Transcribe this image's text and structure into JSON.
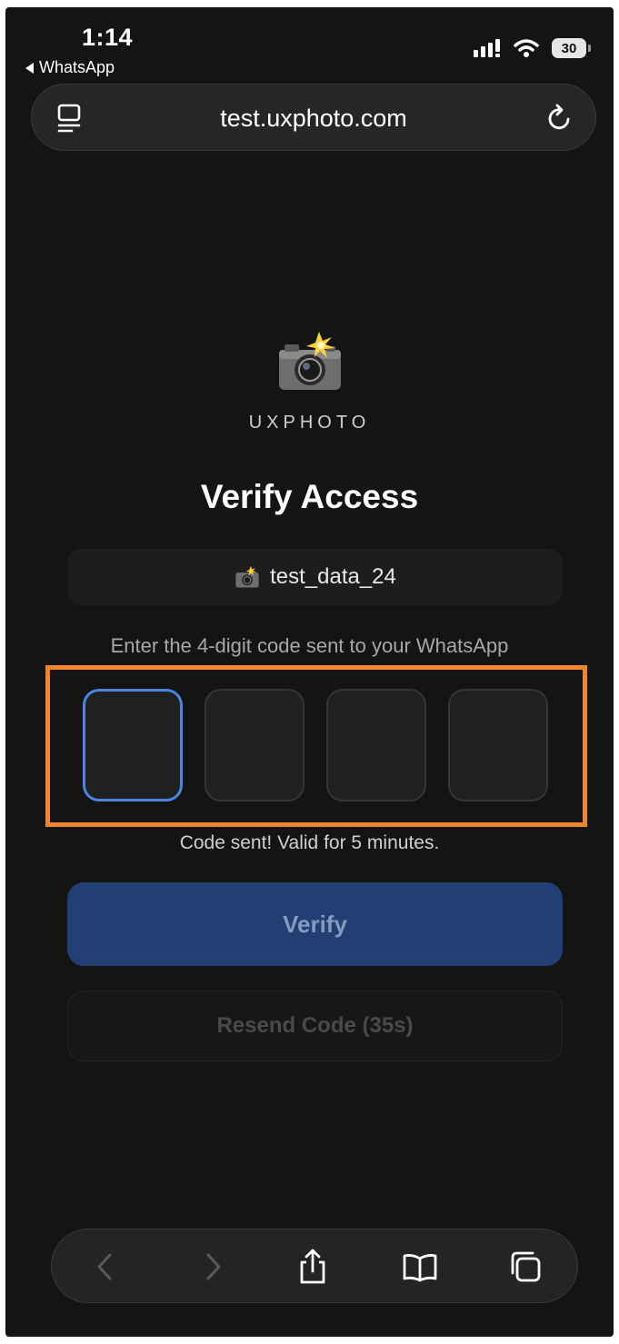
{
  "status_bar": {
    "time": "1:14",
    "back_app": "WhatsApp",
    "battery": "30"
  },
  "browser": {
    "url": "test.uxphoto.com"
  },
  "page": {
    "brand": "UXPHOTO",
    "title": "Verify Access",
    "account": "test_data_24",
    "instruction": "Enter the 4-digit code sent to your WhatsApp",
    "code_digits": [
      "",
      "",
      "",
      ""
    ],
    "status_message": "Code sent! Valid for 5 minutes.",
    "verify_label": "Verify",
    "resend_label": "Resend Code (35s)"
  },
  "colors": {
    "background": "#141414",
    "accent": "#4d84e0",
    "verify_button": "#223f74",
    "highlight": "#f0852c"
  },
  "icons": {
    "logo": "camera-flash-icon",
    "tabs": "tabs-overview-icon",
    "reload": "reload-icon",
    "back": "chevron-left-icon",
    "forward": "chevron-right-icon",
    "share": "share-icon",
    "bookmarks": "book-icon",
    "pages": "pages-icon"
  }
}
